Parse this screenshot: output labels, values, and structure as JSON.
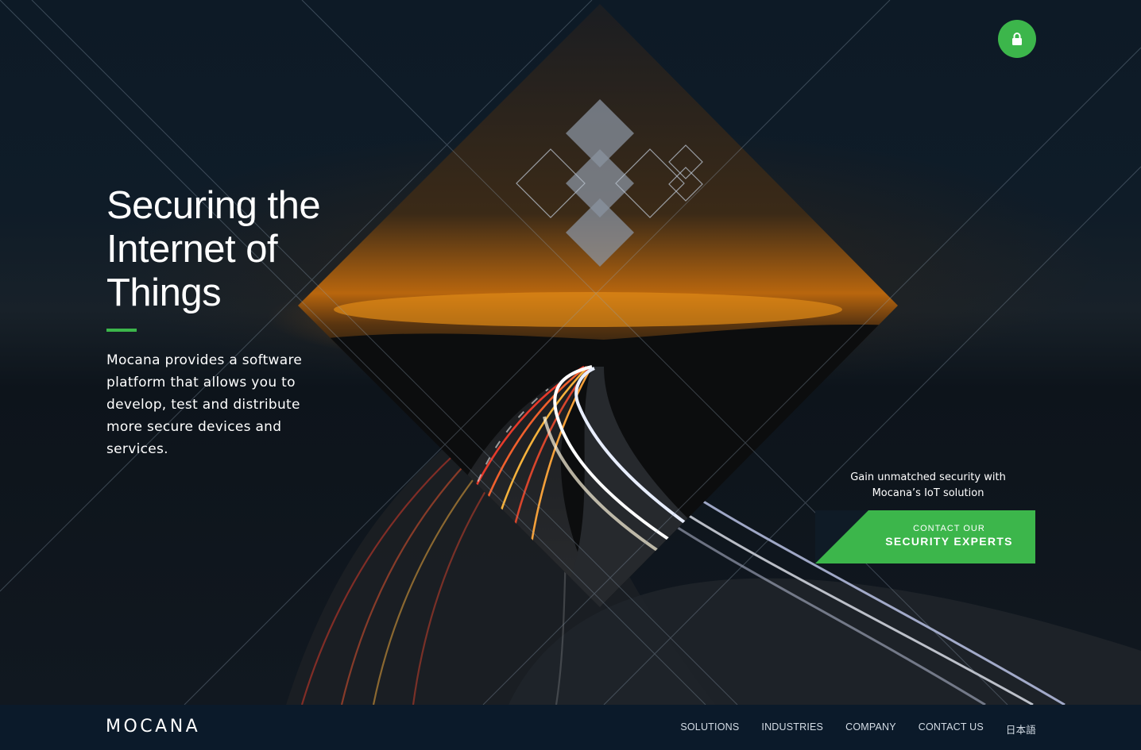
{
  "hero": {
    "headline": "Securing the Internet of Things",
    "intro": "Mocana provides a software platform that allows you to develop, test and distribute more secure devices and services.",
    "lock_icon": "lock-icon"
  },
  "cta": {
    "text": "Gain unmatched security with Mocana’s IoT solution",
    "button_small": "CONTACT OUR",
    "button_big": "SECURITY EXPERTS"
  },
  "footer": {
    "logo": "MOCANA",
    "nav": [
      "SOLUTIONS",
      "INDUSTRIES",
      "COMPANY",
      "CONTACT US",
      "日本語"
    ]
  },
  "colors": {
    "accent": "#3cb64b",
    "footer_bg": "#0b1a2a",
    "dark_bg": "#0f1b26"
  }
}
